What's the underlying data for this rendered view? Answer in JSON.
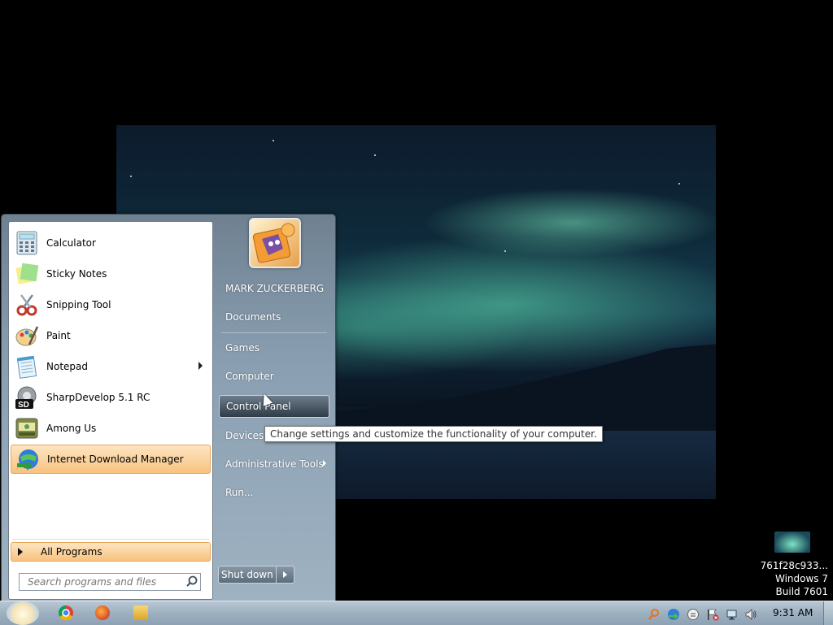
{
  "desktop": {
    "watermark_lines": [
      "761f28c933...",
      "Windows 7",
      "Build 7601"
    ]
  },
  "start_menu": {
    "programs": [
      {
        "label": "Calculator",
        "icon": "calculator-icon",
        "submenu": false,
        "highlighted": false
      },
      {
        "label": "Sticky Notes",
        "icon": "sticky-notes-icon",
        "submenu": false,
        "highlighted": false
      },
      {
        "label": "Snipping Tool",
        "icon": "snipping-tool-icon",
        "submenu": false,
        "highlighted": false
      },
      {
        "label": "Paint",
        "icon": "paint-icon",
        "submenu": false,
        "highlighted": false
      },
      {
        "label": "Notepad",
        "icon": "notepad-icon",
        "submenu": true,
        "highlighted": false
      },
      {
        "label": "SharpDevelop 5.1 RC",
        "icon": "sharpdevelop-icon",
        "submenu": false,
        "highlighted": false
      },
      {
        "label": "Among Us",
        "icon": "among-us-icon",
        "submenu": false,
        "highlighted": false
      },
      {
        "label": "Internet Download Manager",
        "icon": "idm-icon",
        "submenu": false,
        "highlighted": true
      }
    ],
    "all_programs_label": "All Programs",
    "search_placeholder": "Search programs and files",
    "user_name": "MARK ZUCKERBERG",
    "right_items": {
      "documents": "Documents",
      "games": "Games",
      "computer": "Computer",
      "control_panel": "Control Panel",
      "devices": "Devices a",
      "admin_tools": "Administrative Tools",
      "run": "Run..."
    },
    "shutdown_label": "Shut down",
    "tooltip": "Change settings and customize the functionality of your computer."
  },
  "taskbar": {
    "pinned": [
      "chrome-icon",
      "firefox-icon",
      "explorer-icon"
    ],
    "clock": "9:31 AM"
  }
}
